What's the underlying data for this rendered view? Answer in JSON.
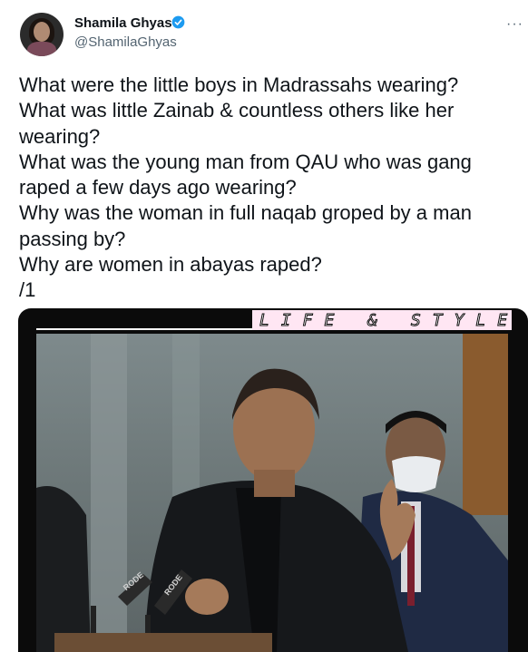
{
  "author": {
    "name": "Shamila Ghyas",
    "handle": "@ShamilaGhyas",
    "verified": true,
    "verified_color": "#1d9bf0"
  },
  "more_label": "···",
  "tweet_lines": [
    "What were the little boys in Madrassahs wearing?",
    "What was little Zainab & countless others like her",
    "wearing?",
    "What was the young man from QAU who was gang",
    "raped a few days ago wearing?",
    "Why was the woman in full naqab groped by a man",
    "passing by?",
    "Why are women in abayas raped?",
    "/1"
  ],
  "media": {
    "banner_text": "LIFE & STYLE",
    "microphone_labels": [
      "RODE",
      "RODE"
    ]
  }
}
